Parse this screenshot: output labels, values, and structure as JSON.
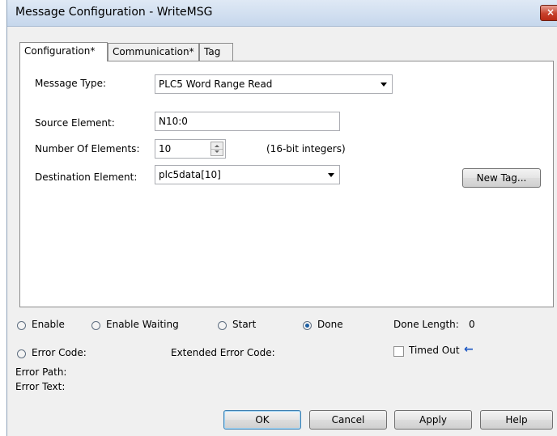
{
  "window": {
    "title": "Message Configuration - WriteMSG",
    "close_glyph": "×"
  },
  "tabs": [
    {
      "label": "Configuration*",
      "active": true
    },
    {
      "label": "Communication*",
      "active": false
    },
    {
      "label": "Tag",
      "active": false
    }
  ],
  "config": {
    "message_type_label": "Message Type:",
    "message_type_value": "PLC5 Word Range Read",
    "source_label": "Source Element:",
    "source_value": "N10:0",
    "num_elements_label": "Number Of Elements:",
    "num_elements_value": "10",
    "num_elements_unit": "(16-bit integers)",
    "dest_label": "Destination Element:",
    "dest_value": "plc5data[10]",
    "new_tag_button": "New Tag..."
  },
  "status": {
    "enable": "Enable",
    "enable_waiting": "Enable Waiting",
    "start": "Start",
    "done": "Done",
    "done_selected": true,
    "done_length_label": "Done Length:",
    "done_length_value": "0",
    "error_code_label": "Error Code:",
    "extended_error_code_label": "Extended Error Code:",
    "timed_out_label": "Timed Out",
    "timed_out_checked": false,
    "timed_out_arrow": "←",
    "error_path_label": "Error Path:",
    "error_text_label": "Error Text:"
  },
  "buttons": {
    "ok": "OK",
    "cancel": "Cancel",
    "apply": "Apply",
    "help": "Help"
  },
  "colors": {
    "accent": "#1c5fa3",
    "close_button": "#c7412c"
  }
}
